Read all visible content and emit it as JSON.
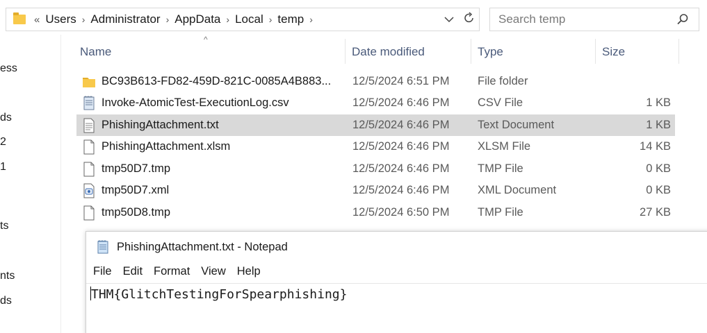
{
  "address": {
    "overflow": "«",
    "crumbs": [
      "Users",
      "Administrator",
      "AppData",
      "Local",
      "temp"
    ]
  },
  "search": {
    "placeholder": "Search temp"
  },
  "left_nav": [
    "ess",
    "ds",
    "2",
    "1",
    "ts",
    "nts",
    "ds"
  ],
  "columns": {
    "name": "Name",
    "date": "Date modified",
    "type": "Type",
    "size": "Size"
  },
  "files": [
    {
      "name": "BC93B613-FD82-459D-821C-0085A4B883...",
      "date": "12/5/2024 6:51 PM",
      "type": "File folder",
      "size": "",
      "icon": "folder-icon"
    },
    {
      "name": "Invoke-AtomicTest-ExecutionLog.csv",
      "date": "12/5/2024 6:46 PM",
      "type": "CSV File",
      "size": "1 KB",
      "icon": "csv-file-icon"
    },
    {
      "name": "PhishingAttachment.txt",
      "date": "12/5/2024 6:46 PM",
      "type": "Text Document",
      "size": "1 KB",
      "icon": "text-file-icon",
      "selected": true
    },
    {
      "name": "PhishingAttachment.xlsm",
      "date": "12/5/2024 6:46 PM",
      "type": "XLSM File",
      "size": "14 KB",
      "icon": "blank-file-icon"
    },
    {
      "name": "tmp50D7.tmp",
      "date": "12/5/2024 6:46 PM",
      "type": "TMP File",
      "size": "0 KB",
      "icon": "blank-file-icon"
    },
    {
      "name": "tmp50D7.xml",
      "date": "12/5/2024 6:46 PM",
      "type": "XML Document",
      "size": "0 KB",
      "icon": "xml-file-icon"
    },
    {
      "name": "tmp50D8.tmp",
      "date": "12/5/2024 6:50 PM",
      "type": "TMP File",
      "size": "27 KB",
      "icon": "blank-file-icon"
    }
  ],
  "notepad": {
    "title": "PhishingAttachment.txt - Notepad",
    "menu": [
      "File",
      "Edit",
      "Format",
      "View",
      "Help"
    ],
    "content": "THM{GlitchTestingForSpearphishing}"
  },
  "colors": {
    "selected_row": "#d9d9d9",
    "header_text": "#4a5a7a",
    "folder": "#f8c94b"
  }
}
